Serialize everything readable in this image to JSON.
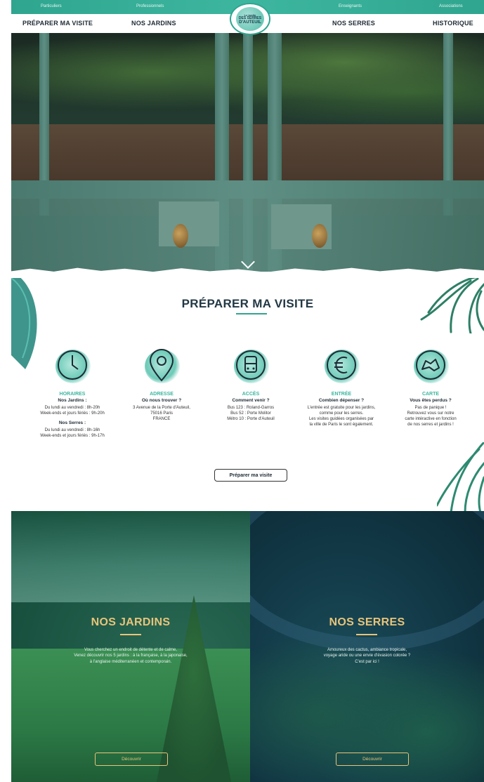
{
  "topbar": {
    "links": [
      "Particuliers",
      "Professionnels",
      "Enseignants",
      "Associations"
    ]
  },
  "nav": {
    "items": [
      "PRÉPARER MA VISITE",
      "NOS JARDINS",
      "NOS SERRES",
      "HISTORIQUE"
    ],
    "logo_lines": [
      "Le jardin",
      "DES SERRES",
      "D'AUTEUIL"
    ]
  },
  "section": {
    "title": "PRÉPARER MA VISITE"
  },
  "features": [
    {
      "icon": "clock-icon",
      "title": "HORAIRES",
      "subtitle": "Nos Jardins :",
      "lines": [
        "Du lundi au vendredi : 8h-20h",
        "Week-ends et jours fériés : 9h-20h"
      ],
      "subtitle2": "Nos Serres :",
      "lines2": [
        "Du lundi au vendredi : 8h-16h",
        "Week-ends et jours fériés : 9h-17h"
      ]
    },
    {
      "icon": "location-pin-icon",
      "title": "ADRESSE",
      "subtitle": "Où nous trouver ?",
      "lines": [
        "3 Avenue de la Porte d'Auteuil,",
        "75016 Paris",
        "FRANCE"
      ]
    },
    {
      "icon": "bus-icon",
      "title": "ACCÈS",
      "subtitle": "Comment venir ?",
      "lines": [
        "Bus 123 : Roland-Garros",
        "Bus 52 : Porte Molitor",
        "Métro 10 : Porte d'Auteuil"
      ]
    },
    {
      "icon": "euro-icon",
      "title": "ENTRÉE",
      "subtitle": "Combien dépenser ?",
      "lines": [
        "L'entrée est gratuite pour les jardins,",
        "comme pour les serres.",
        "Les visites guidées organisées par",
        "la ville de Paris le sont également."
      ]
    },
    {
      "icon": "map-icon",
      "title": "CARTE",
      "subtitle": "Vous êtes perdus ?",
      "lines": [
        "Pas de panique !",
        "Retrouvez vous sur notre",
        "carte intéractive en fonction",
        "de nos serres et jardins !"
      ]
    }
  ],
  "prepare_button": "Préparer ma visite",
  "panels": {
    "jardins": {
      "title": "NOS JARDINS",
      "text": [
        "Vous cherchez un endroit de détente et de calme,",
        "Venez découvrir nos 5 jardins : à la française, à la japonaise,",
        "à l'anglaise méditerranéen et contemporain."
      ],
      "cta": "Découvrir"
    },
    "serres": {
      "title": "NOS SERRES",
      "text": [
        "Amoureux des cactus, ambiance tropicale,",
        "voyage aride ou une envie d'évasion colorée ?",
        "C'est par ici !"
      ],
      "cta": "Découvrir"
    }
  },
  "colors": {
    "accent": "#3db6a0",
    "gold": "#e8c47b",
    "dark": "#1e2a34"
  }
}
